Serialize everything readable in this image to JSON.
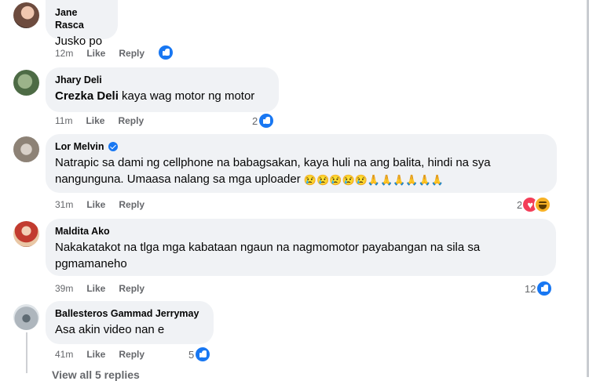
{
  "comments": [
    {
      "name": "Jane Rasca",
      "text": "Jusko po",
      "time": "12m",
      "like": "Like",
      "reply": "Reply",
      "reaction_count": ""
    },
    {
      "name": "Jhary Deli",
      "tag": "Crezka Deli",
      "text": "kaya wag motor ng motor",
      "time": "11m",
      "like": "Like",
      "reply": "Reply",
      "reaction_count": "2"
    },
    {
      "name": "Lor Melvin",
      "verified": true,
      "text_line1": "Natrapic sa dami ng cellphone na babagsakan, kaya huli na ang balita, hindi na sya",
      "text_line2": "nangunguna. Umaasa nalang sa mga uploader",
      "emojis": "😢😢😢😢😢🙏🙏🙏🙏🙏🙏",
      "time": "31m",
      "like": "Like",
      "reply": "Reply",
      "reaction_count": "2"
    },
    {
      "name": "Maldita Ako",
      "text_line1": "Nakakatakot na tlga mga kabataan ngaun na nagmomotor payabangan na sila sa",
      "text_line2": "pgmamaneho",
      "time": "39m",
      "like": "Like",
      "reply": "Reply",
      "reaction_count": "12"
    },
    {
      "name": "Ballesteros Gammad Jerrymay",
      "text": "Asa akin video nan e",
      "time": "41m",
      "like": "Like",
      "reply": "Reply",
      "reaction_count": "5"
    }
  ],
  "view_all": "View all 5 replies"
}
